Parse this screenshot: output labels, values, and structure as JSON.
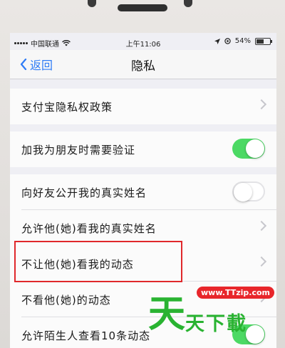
{
  "status_bar": {
    "carrier": "中国联通",
    "time": "上午11:06",
    "battery": "54%",
    "battery_level": 0.54
  },
  "nav": {
    "back_label": "返回",
    "title": "隐私"
  },
  "settings": [
    {
      "label": "支付宝隐私权政策",
      "control": "chevron"
    },
    {
      "label": "加我为朋友时需要验证",
      "control": "toggle",
      "on": true
    },
    {
      "label": "向好友公开我的真实姓名",
      "control": "toggle",
      "on": false
    },
    {
      "label": "允许他(她)看我的真实姓名",
      "control": "chevron"
    },
    {
      "label": "不让他(她)看我的动态",
      "control": "chevron",
      "highlighted": true
    },
    {
      "label": "不看他(她)的动态",
      "control": "chevron"
    },
    {
      "label": "允许陌生人查看10条动态",
      "control": "toggle",
      "on": true
    }
  ],
  "watermark": {
    "url": "www.TTzip.com",
    "big_char": "天",
    "text": "天下載"
  },
  "colors": {
    "accent_blue": "#2f7cf6",
    "toggle_on": "#4cd964",
    "highlight_red": "#e0282b",
    "watermark_green": "#29b331"
  }
}
